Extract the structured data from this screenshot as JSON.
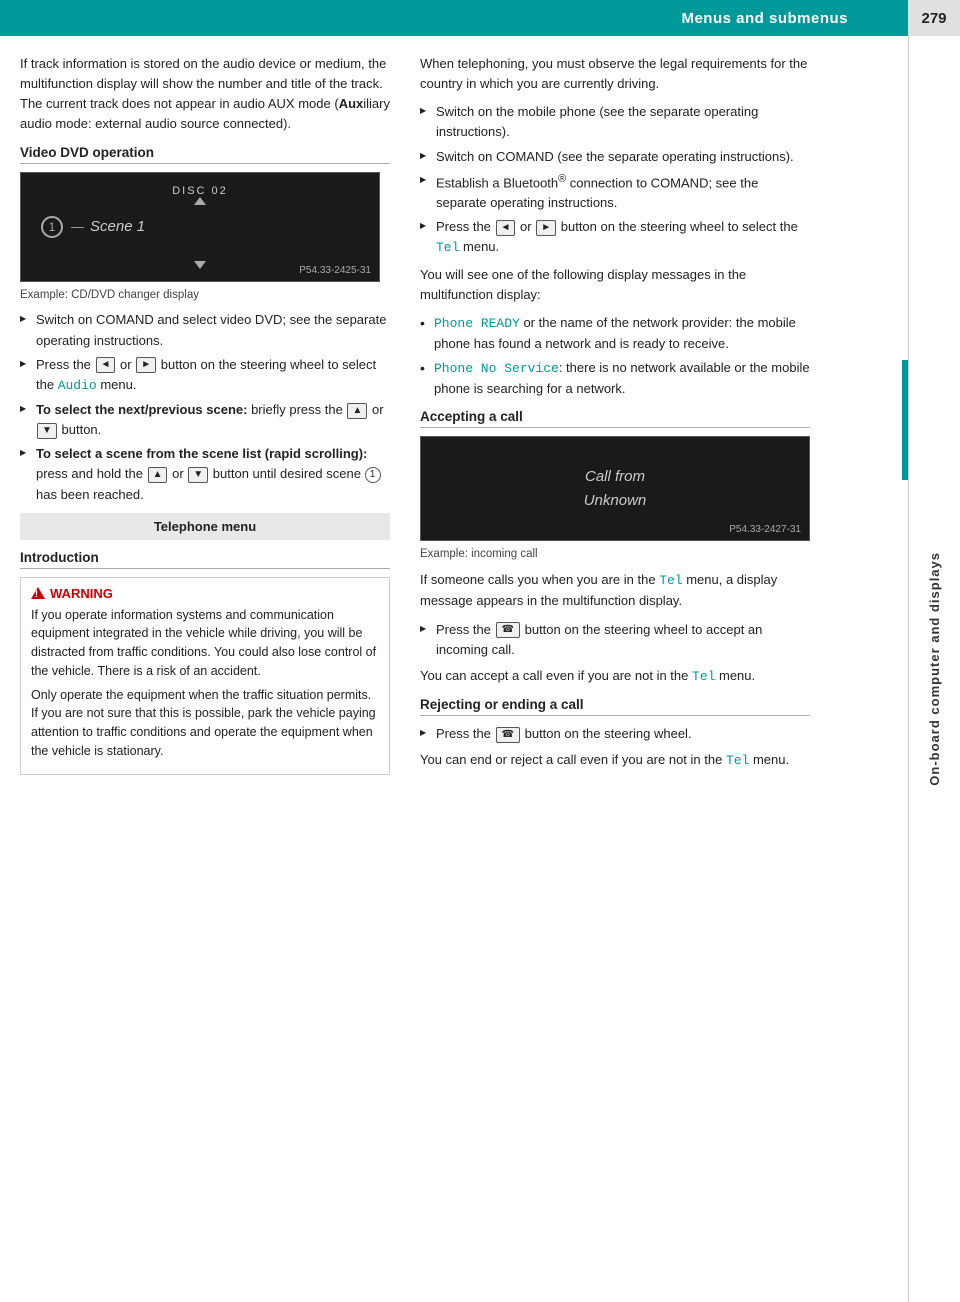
{
  "header": {
    "title": "Menus and submenus",
    "page_number": "279",
    "sidebar_label": "On-board computer and displays"
  },
  "left_col": {
    "intro_text": "If track information is stored on the audio device or medium, the multifunction display will show the number and title of the track. The current track does not appear in audio AUX mode (",
    "aux_bold": "Aux",
    "aux_rest": "iliary audio mode: external audio source connected).",
    "video_section": {
      "heading": "Video DVD operation",
      "dvd_disc": "DISC 02",
      "dvd_scene": "Scene 1",
      "dvd_num": "1",
      "dvd_ref": "P54.33-2425-31",
      "caption": "Example: CD/DVD changer display",
      "bullets": [
        "Switch on COMAND and select video DVD; see the separate operating instructions.",
        "Press the [◄] or [►] button on the steering wheel to select the Audio menu.",
        "To select the next/previous scene: briefly press the [▲] or [▼] button.",
        "To select a scene from the scene list (rapid scrolling): press and hold the [▲] or [▼] button until desired scene ① has been reached."
      ]
    },
    "telephone_section": {
      "gray_label": "Telephone menu",
      "intro_heading": "Introduction",
      "warning_title": "WARNING",
      "warning_para1": "If you operate information systems and communication equipment integrated in the vehicle while driving, you will be distracted from traffic conditions. You could also lose control of the vehicle. There is a risk of an accident.",
      "warning_para2": "Only operate the equipment when the traffic situation permits. If you are not sure that this is possible, park the vehicle paying attention to traffic conditions and operate the equipment when the vehicle is stationary."
    }
  },
  "right_col": {
    "intro_text": "When telephoning, you must observe the legal requirements for the country in which you are currently driving.",
    "bullets": [
      {
        "text": "Switch on the mobile phone (see the separate operating instructions)."
      },
      {
        "text": "Switch on COMAND (see the separate operating instructions)."
      },
      {
        "text": "Establish a Bluetooth® connection to COMAND; see the separate operating instructions.",
        "establish_prefix": "Establish a Bluetooth"
      },
      {
        "text": "Press the [◄] or [►] button on the steering wheel to select the Tel menu.",
        "has_tel": true
      }
    ],
    "display_msg_intro": "You will see one of the following display messages in the multifunction display:",
    "dot_bullets": [
      {
        "text_prefix": "Phone READY",
        "text_mono": "Phone READY",
        "text_rest": " or the name of the network provider: the mobile phone has found a network and is ready to receive.",
        "is_mono": true
      },
      {
        "text_prefix": "Phone No Service",
        "text_mono": "Phone No Service",
        "text_rest": ": there is no network available or the mobile phone is searching for a network.",
        "is_mono": true
      }
    ],
    "accepting_section": {
      "heading": "Accepting a call",
      "call_text_line1": "Call from",
      "call_text_line2": "Unknown",
      "call_ref": "P54.33-2427-31",
      "caption": "Example: incoming call",
      "para1_prefix": "If someone calls you when you are in the ",
      "para1_tel": "Tel",
      "para1_suffix": " menu, a display message appears in the multifunction display.",
      "bullet": "Press the [☎] button on the steering wheel to accept an incoming call.",
      "para2_prefix": "You can accept a call even if you are not in the ",
      "para2_tel": "Tel",
      "para2_suffix": " menu."
    },
    "rejecting_section": {
      "heading": "Rejecting or ending a call",
      "bullet": "Press the [☎] button on the steering wheel.",
      "para_prefix": "You can end or reject a call even if you are not in the ",
      "para_tel": "Tel",
      "para_suffix": " menu."
    }
  }
}
